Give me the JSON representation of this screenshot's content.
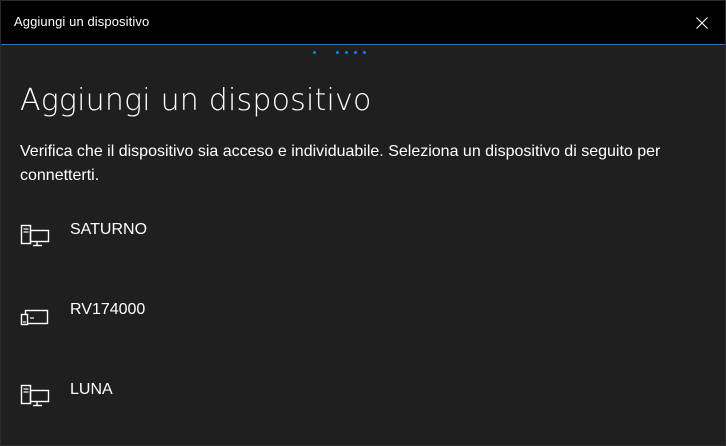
{
  "window": {
    "title": "Aggiungi un dispositivo",
    "close_icon": "close-icon"
  },
  "main": {
    "heading": "Aggiungi un dispositivo",
    "instructions": "Verifica che il dispositivo sia acceso e individuabile. Seleziona un dispositivo di seguito per connetterti."
  },
  "devices": [
    {
      "name": "SATURNO",
      "icon": "desktop-computer-icon"
    },
    {
      "name": "RV174000",
      "icon": "display-device-icon"
    },
    {
      "name": "LUNA",
      "icon": "desktop-computer-icon"
    }
  ],
  "colors": {
    "background": "#1f1f1f",
    "titlebar": "#000000",
    "accent": "#0a84ff",
    "text": "#ffffff"
  }
}
